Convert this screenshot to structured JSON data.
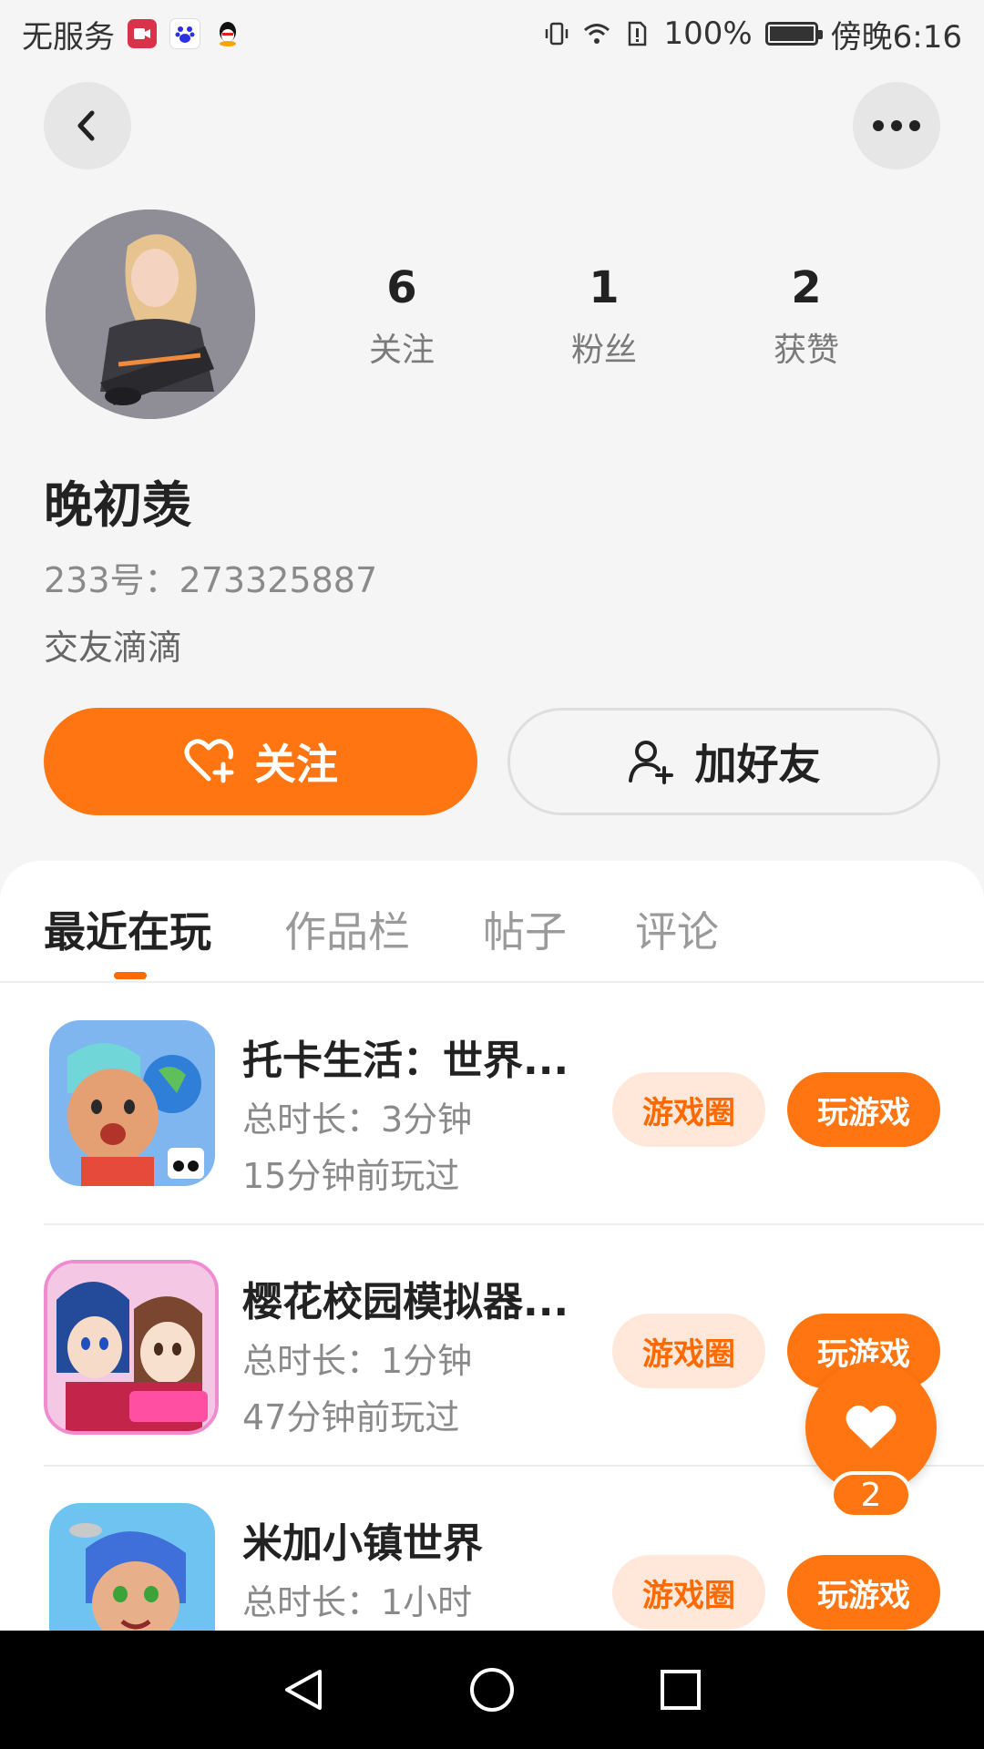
{
  "status_bar": {
    "carrier": "无服务",
    "battery": "100%",
    "battery_level": 1.0,
    "time": "傍晚6:16"
  },
  "profile": {
    "stats": [
      {
        "value": "6",
        "label": "关注"
      },
      {
        "value": "1",
        "label": "粉丝"
      },
      {
        "value": "2",
        "label": "获赞"
      }
    ],
    "name": "晚初羡",
    "id_text": "233号：273325887",
    "bio": "交友滴滴",
    "follow_label": "关注",
    "add_friend_label": "加好友"
  },
  "tabs": [
    {
      "label": "最近在玩",
      "active": true
    },
    {
      "label": "作品栏",
      "active": false
    },
    {
      "label": "帖子",
      "active": false
    },
    {
      "label": "评论",
      "active": false
    }
  ],
  "games": [
    {
      "name": "托卡生活：世界...",
      "duration": "总时长：3分钟",
      "last_played": "15分钟前玩过",
      "circle_label": "游戏圈",
      "play_label": "玩游戏"
    },
    {
      "name": "樱花校园模拟器...",
      "duration": "总时长：1分钟",
      "last_played": "47分钟前玩过",
      "circle_label": "游戏圈",
      "play_label": "玩游戏"
    },
    {
      "name": "米加小镇世界",
      "duration": "总时长：1小时",
      "last_played": "",
      "circle_label": "游戏圈",
      "play_label": "玩游戏"
    }
  ],
  "float_like": {
    "count": "2"
  },
  "colors": {
    "accent": "#ff7511",
    "accent_light": "#ffe8d9",
    "text": "#222222",
    "muted": "#8a8a8a"
  }
}
